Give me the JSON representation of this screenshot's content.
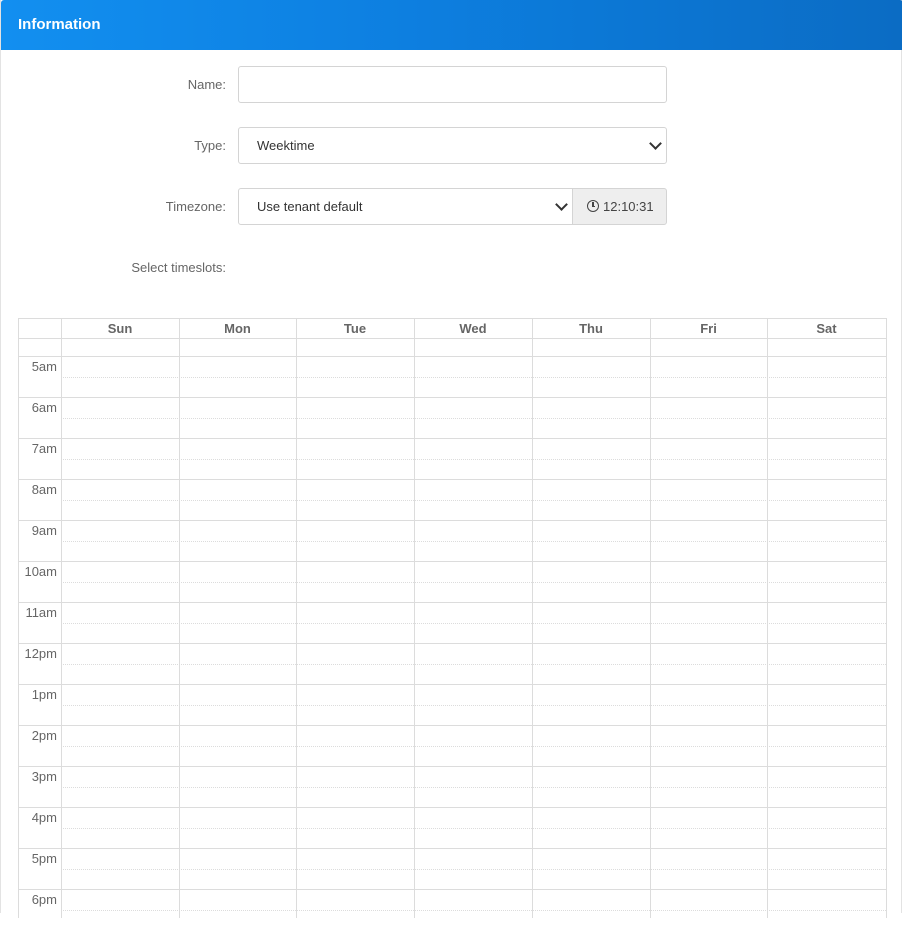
{
  "panel": {
    "title": "Information"
  },
  "form": {
    "name_label": "Name:",
    "name_value": "",
    "type_label": "Type:",
    "type_value": "Weektime",
    "timezone_label": "Timezone:",
    "timezone_value": "Use tenant default",
    "timezone_time": "12:10:31",
    "timeslots_label": "Select timeslots:"
  },
  "calendar": {
    "days": [
      "Sun",
      "Mon",
      "Tue",
      "Wed",
      "Thu",
      "Fri",
      "Sat"
    ],
    "hours": [
      "5am",
      "6am",
      "7am",
      "8am",
      "9am",
      "10am",
      "11am",
      "12pm",
      "1pm",
      "2pm",
      "3pm",
      "4pm",
      "5pm",
      "6pm"
    ]
  },
  "icons": {
    "clock": "clock-icon",
    "dropdown": "chevron-down-icon"
  }
}
